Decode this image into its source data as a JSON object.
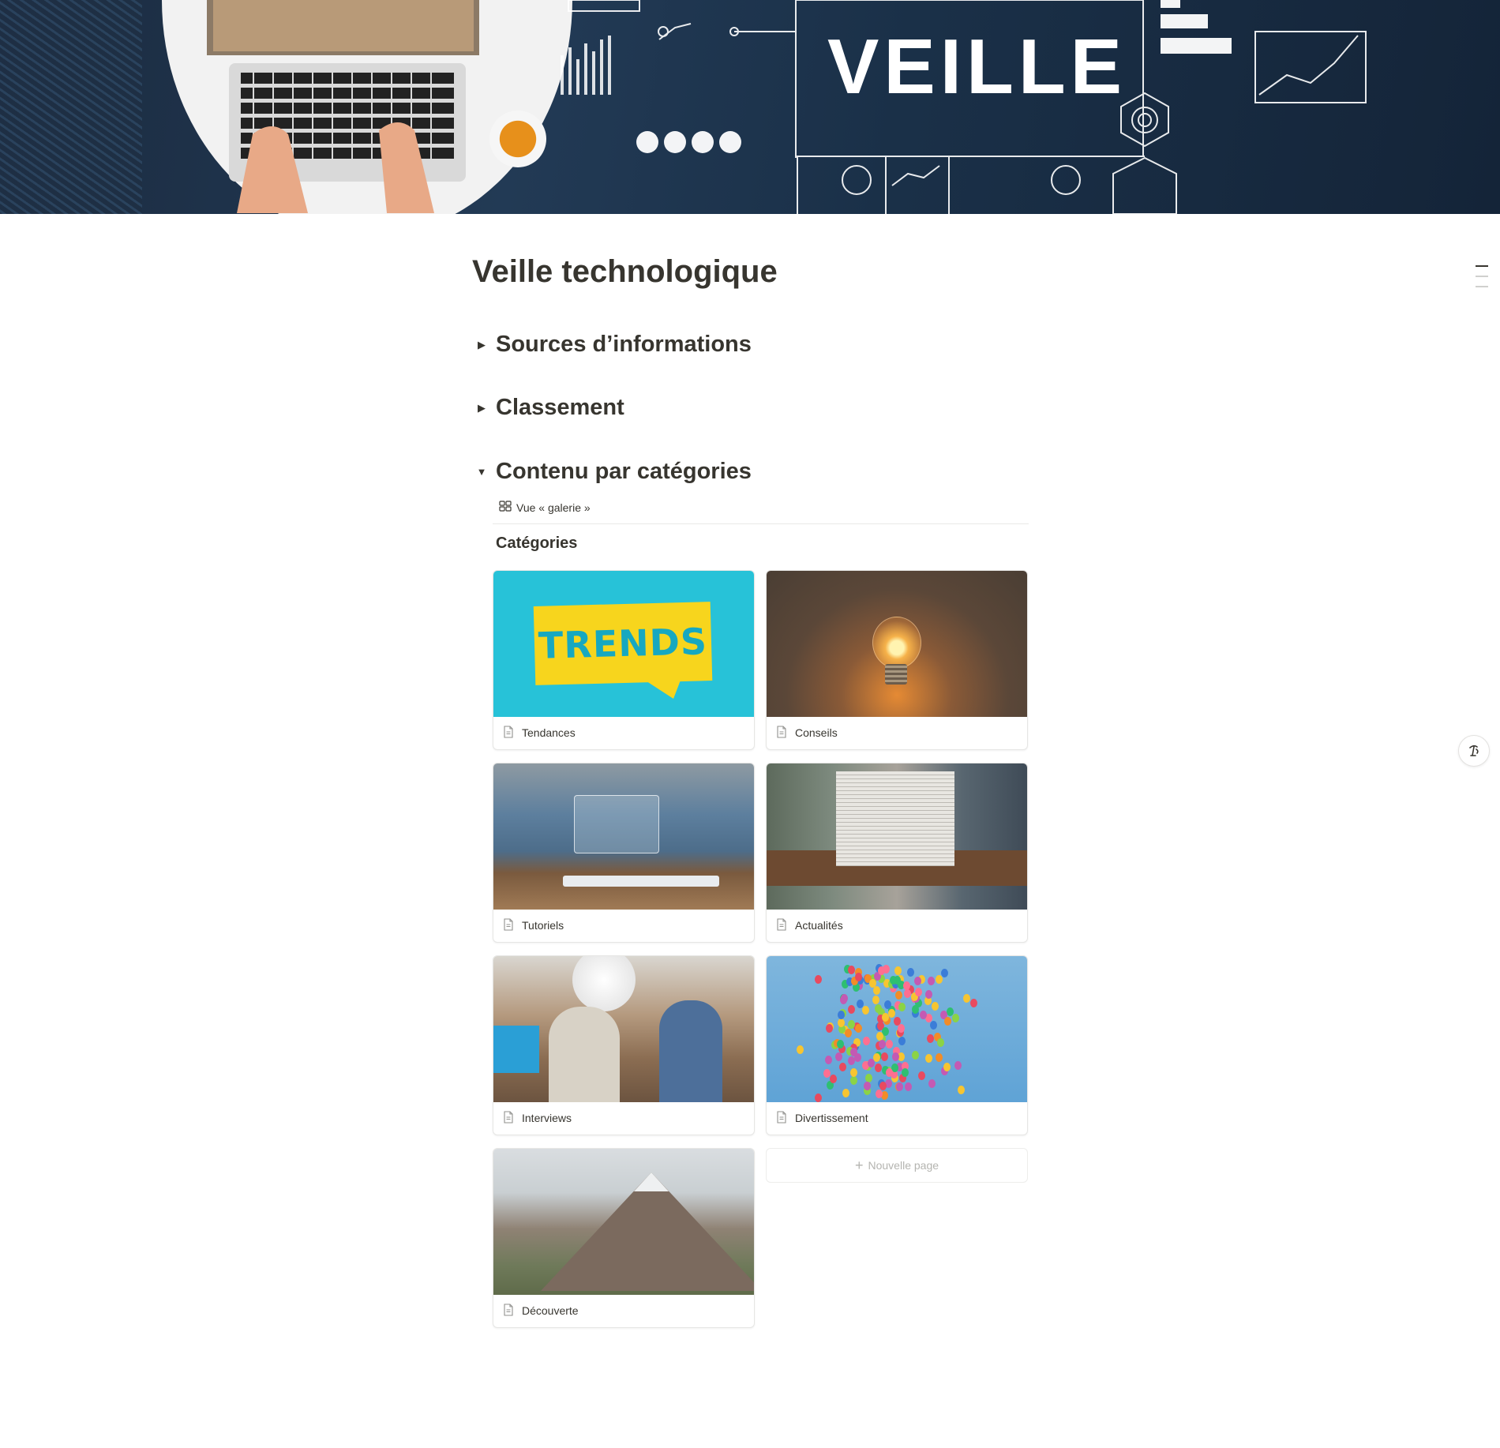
{
  "cover": {
    "banner_text": "VEILLE"
  },
  "page": {
    "title": "Veille technologique"
  },
  "toggles": [
    {
      "label": "Sources d’informations",
      "expanded": false
    },
    {
      "label": "Classement",
      "expanded": false
    },
    {
      "label": "Contenu par catégories",
      "expanded": true
    }
  ],
  "database": {
    "view_label": "Vue « galerie »",
    "title": "Catégories",
    "cards": [
      {
        "label": "Tendances",
        "image": "trends-speech-bubble"
      },
      {
        "label": "Conseils",
        "image": "light-bulb"
      },
      {
        "label": "Tutoriels",
        "image": "hand-touch-screen"
      },
      {
        "label": "Actualités",
        "image": "person-reading-newspaper"
      },
      {
        "label": "Interviews",
        "image": "podcast-studio"
      },
      {
        "label": "Divertissement",
        "image": "balloons-sky"
      },
      {
        "label": "Découverte",
        "image": "mountain-landscape"
      }
    ],
    "trends_image_text": "TRENDS",
    "new_page_label": "Nouvelle page"
  },
  "icons": {
    "toggle_collapsed": "triangle-right-icon",
    "toggle_expanded": "triangle-down-icon",
    "gallery_view": "grid-icon",
    "page": "page-icon",
    "add": "plus-icon",
    "ai_assistant": "notion-ai-icon",
    "toc": "table-of-contents-icon"
  },
  "colors": {
    "text": "#37352f",
    "muted": "#b4b4b0",
    "border": "#e6e6e4"
  }
}
